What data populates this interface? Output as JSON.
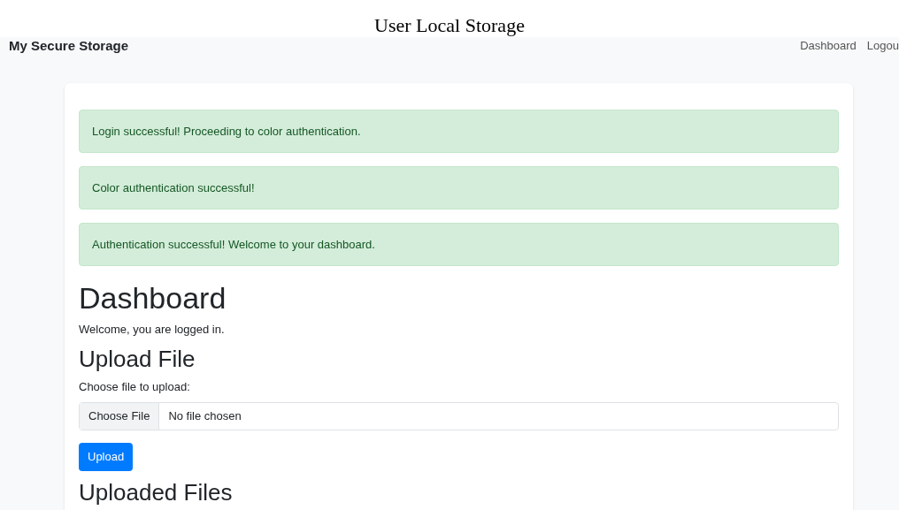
{
  "caption": "User Local Storage",
  "navbar": {
    "brand": "My Secure Storage",
    "links": [
      "Dashboard",
      "Logou"
    ]
  },
  "alerts": [
    {
      "kind": "success",
      "text": "Login successful! Proceeding to color authentication."
    },
    {
      "kind": "success",
      "text": "Color authentication successful!"
    },
    {
      "kind": "success",
      "text": "Authentication successful! Welcome to your dashboard."
    }
  ],
  "heading": "Dashboard",
  "welcome": "Welcome, you are logged in.",
  "upload": {
    "heading": "Upload File",
    "label": "Choose file to upload:",
    "choose_button": "Choose File",
    "file_status": "No file chosen",
    "submit": "Upload"
  },
  "files_heading": "Uploaded Files"
}
